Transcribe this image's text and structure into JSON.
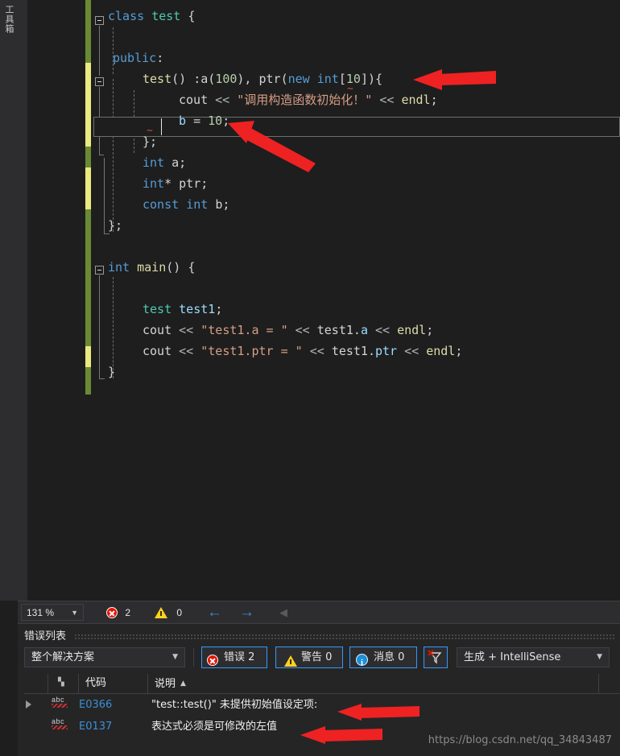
{
  "toolbox": {
    "label": "工具箱"
  },
  "editor": {
    "language": "cpp",
    "current_line_text": "b = 10;",
    "lines": [
      {
        "n": 1,
        "indent": 0,
        "text": "class test {"
      },
      {
        "n": 2,
        "indent": 0,
        "text": ""
      },
      {
        "n": 3,
        "indent": 1,
        "text": "public:"
      },
      {
        "n": 4,
        "indent": 2,
        "text": "test() :a(100), ptr(new int[10]){"
      },
      {
        "n": 5,
        "indent": 3,
        "text": "cout << \"调用构造函数初始化！\" << endl;"
      },
      {
        "n": 6,
        "indent": 3,
        "text": "b = 10;"
      },
      {
        "n": 7,
        "indent": 2,
        "text": "};"
      },
      {
        "n": 8,
        "indent": 2,
        "text": "int a;"
      },
      {
        "n": 9,
        "indent": 2,
        "text": "int* ptr;"
      },
      {
        "n": 10,
        "indent": 2,
        "text": "const int b;"
      },
      {
        "n": 11,
        "indent": 0,
        "text": "};"
      },
      {
        "n": 12,
        "indent": 0,
        "text": ""
      },
      {
        "n": 13,
        "indent": 0,
        "text": "int main() {"
      },
      {
        "n": 14,
        "indent": 0,
        "text": ""
      },
      {
        "n": 15,
        "indent": 2,
        "text": "test test1;"
      },
      {
        "n": 16,
        "indent": 2,
        "text": "cout << \"test1.a = \" << test1.a << endl;"
      },
      {
        "n": 17,
        "indent": 2,
        "text": "cout << \"test1.ptr = \" << test1.ptr << endl;"
      },
      {
        "n": 18,
        "indent": 1,
        "text": "}"
      }
    ]
  },
  "status_bar": {
    "zoom": "131 %",
    "error_count": "2",
    "warning_count": "0",
    "prev_label": "←",
    "next_label": "→",
    "collapse_label": "◀"
  },
  "error_list": {
    "title": "错误列表",
    "scope": "整个解决方案",
    "errors_label": "错误 2",
    "warnings_label": "警告 0",
    "messages_label": "消息 0",
    "build_filter": "生成 + IntelliSense",
    "columns": [
      {
        "key": "expander",
        "label": ""
      },
      {
        "key": "icon",
        "label": ""
      },
      {
        "key": "code",
        "label": "代码"
      },
      {
        "key": "description",
        "label": "说明",
        "sorted": "asc",
        "sort_glyph": "▲"
      }
    ],
    "rows": [
      {
        "expandable": true,
        "icon": "abc-squiggle-icon",
        "code": "E0366",
        "description": "\"test::test()\" 未提供初始值设定项:"
      },
      {
        "expandable": false,
        "icon": "abc-squiggle-icon",
        "code": "E0137",
        "description": "表达式必须是可修改的左值"
      }
    ]
  },
  "watermark": {
    "text": "https://blog.csdn.net/qq_34843487"
  },
  "colors": {
    "editor_bg": "#1e1e1e",
    "chrome_bg": "#2d2d30",
    "panel_bg": "#252526",
    "keyword": "#569cd6",
    "type": "#4ec9b0",
    "string": "#d69d85",
    "number": "#b5cea8",
    "function": "#dcdcaa",
    "variable": "#9cdcfe",
    "accent_blue": "#3399ff",
    "error_red": "#e51400",
    "warning_yellow": "#ffd21e",
    "changebar_saved": "#6a8a35",
    "changebar_unsaved": "#eaea80",
    "annotation_arrow": "#ee2222"
  }
}
